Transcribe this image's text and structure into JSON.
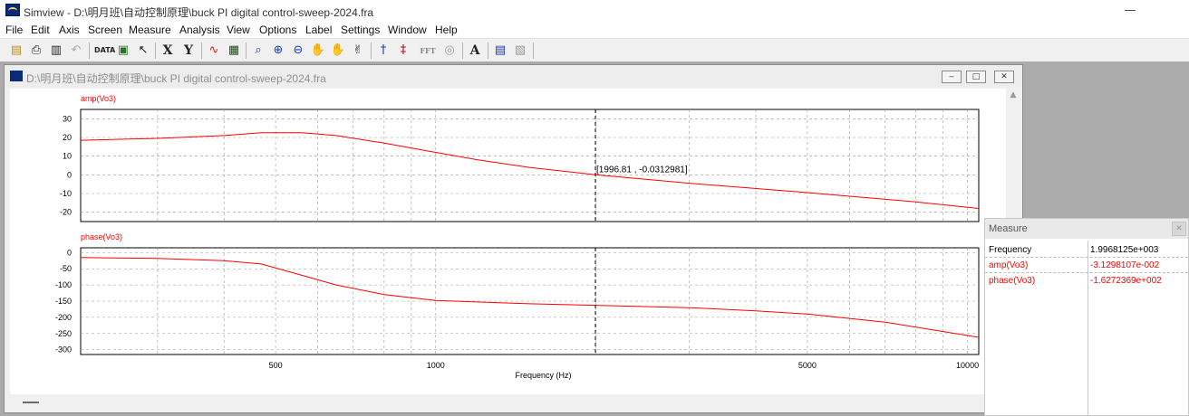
{
  "window": {
    "title": "Simview - D:\\明月班\\自动控制原理\\buck PI digital control-sweep-2024.fra",
    "minimize": "—",
    "maximize": "☐",
    "close": "✕"
  },
  "menu": [
    "File",
    "Edit",
    "Axis",
    "Screen",
    "Measure",
    "Analysis",
    "View",
    "Options",
    "Label",
    "Settings",
    "Window",
    "Help"
  ],
  "toolbar": {
    "x_label": "X",
    "y_label": "Y",
    "fft_label": "FFT",
    "text_label": "A",
    "data_label": "DATA",
    "icons": [
      "open-folder-icon",
      "print-icon",
      "clipboard-icon",
      "undo-icon",
      "data-icon",
      "data-chart-icon",
      "pointer-icon",
      "x-axis-icon",
      "y-axis-icon",
      "add-curve-icon",
      "grid-icon",
      "zoom-icon",
      "zoom-in-icon",
      "zoom-out-icon",
      "hand-icon",
      "hand-plus-icon",
      "hand-move-icon",
      "cursor-icon",
      "cursor-peak-icon",
      "fft-icon",
      "globe-icon",
      "text-icon",
      "export-icon",
      "settings-icon"
    ]
  },
  "child": {
    "title": "D:\\明月班\\自动控制原理\\buck PI digital control-sweep-2024.fra"
  },
  "chart_data": [
    {
      "type": "line",
      "title": "amp(Vo3)",
      "x_scale": "log",
      "xlim": [
        215,
        10500
      ],
      "ylim": [
        -25,
        35
      ],
      "yticks": [
        30,
        20,
        10,
        0,
        -10,
        -20
      ],
      "grid": true,
      "series": [
        {
          "name": "amp(Vo3)",
          "color": "#ff0000",
          "x": [
            215,
            300,
            400,
            470,
            560,
            650,
            800,
            1000,
            1200,
            1500,
            2000,
            3000,
            5000,
            8000,
            10500
          ],
          "y": [
            18.5,
            19.5,
            21,
            22.5,
            22.5,
            21,
            17,
            12,
            8,
            4,
            0,
            -4.5,
            -9.5,
            -14.5,
            -18
          ]
        }
      ],
      "annotation": "[1996.81 , -0.0312981]"
    },
    {
      "type": "line",
      "title": "phase(Vo3)",
      "x_scale": "log",
      "xlim": [
        215,
        10500
      ],
      "ylim": [
        -315,
        15
      ],
      "yticks": [
        0,
        -50,
        -100,
        -150,
        -200,
        -250,
        -300
      ],
      "xticks": [
        500,
        1000,
        5000,
        10000
      ],
      "xlabel": "Frequency (Hz)",
      "grid": true,
      "series": [
        {
          "name": "phase(Vo3)",
          "color": "#ff0000",
          "x": [
            215,
            300,
            400,
            470,
            560,
            650,
            800,
            1000,
            1500,
            2000,
            3000,
            4000,
            5000,
            7000,
            10500
          ],
          "y": [
            -15,
            -18,
            -25,
            -35,
            -70,
            -100,
            -130,
            -148,
            -158,
            -163,
            -170,
            -180,
            -190,
            -215,
            -262
          ]
        }
      ]
    }
  ],
  "cursor": {
    "x": 1996.81,
    "y": -0.0312981
  },
  "measure": {
    "title": "Measure",
    "close": "✕",
    "rows": [
      {
        "label": "Frequency",
        "value": "1.9968125e+003",
        "color": "#000000"
      },
      {
        "label": "amp(Vo3)",
        "value": "-3.1298107e-002",
        "color": "#ff0000"
      },
      {
        "label": "phase(Vo3)",
        "value": "-1.6272369e+002",
        "color": "#ff0000"
      }
    ]
  }
}
